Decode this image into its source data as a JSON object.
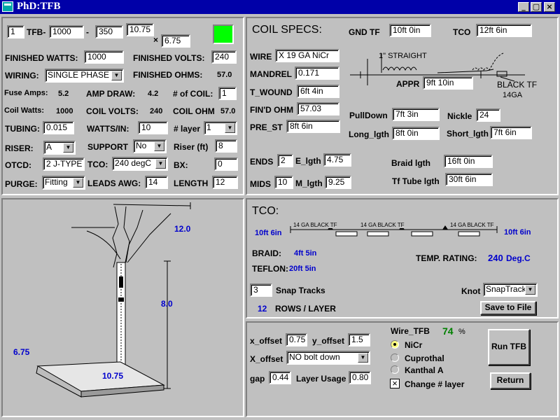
{
  "window": {
    "title": "PhD:TFB",
    "min_symbol": "_",
    "max_symbol": "▢",
    "close_symbol": "×",
    "icon": "app-icon"
  },
  "top": {
    "count": "1",
    "tfb_label": "TFB-",
    "tfb_a": "1000",
    "dash": "-",
    "tfb_b": "350",
    "dim_a": "10.75",
    "times": "×",
    "dim_b": "6.75",
    "status_color": "#00ff00"
  },
  "left": {
    "finished_watts_label": "FINISHED WATTS:",
    "finished_watts": "1000",
    "finished_volts_label": "FINISHED VOLTS:",
    "finished_volts": "240",
    "wiring_label": "WIRING:",
    "wiring": "SINGLE PHASE",
    "finished_ohms_label": "FINISHED OHMS:",
    "finished_ohms": "57.0",
    "fuse_amps_label": "Fuse Amps:",
    "fuse_amps": "5.2",
    "amp_draw_label": "AMP DRAW:",
    "amp_draw": "4.2",
    "num_coil_label": "# of COIL:",
    "num_coil": "1",
    "coil_watts_label": "Coil Watts:",
    "coil_watts": "1000",
    "coil_volts_label": "COIL VOLTS:",
    "coil_volts": "240",
    "coil_ohm_label": "COIL OHM",
    "coil_ohm": "57.0",
    "tubing_label": "TUBING:",
    "tubing": "0.015",
    "watts_in_label": "WATTS/IN:",
    "watts_in": "10",
    "layer_label": "# layer",
    "layer": "1",
    "riser_label": "RISER:",
    "riser": "A",
    "support_label": "SUPPORT",
    "support": "No",
    "riser_ft_label": "Riser (ft)",
    "riser_ft": "8",
    "otcd_label": "OTCD:",
    "otcd": "2 J-TYPE",
    "tco_label": "TCO:",
    "tco": "240 degC",
    "bx_label": "BX:",
    "bx": "0",
    "purge_label": "PURGE:",
    "purge": "Fitting",
    "leads_awg_label": "LEADS AWG:",
    "leads_awg": "14",
    "length_label": "LENGTH",
    "length": "12"
  },
  "coil": {
    "heading": "COIL SPECS:",
    "gnd_tf_label": "GND TF",
    "gnd_tf": "10ft 0in",
    "tco_label": "TCO",
    "tco": "12ft 6in",
    "wire_label": "WIRE",
    "wire": "X 19 GA NiCr",
    "mandrel_label": "MANDREL",
    "mandrel": "0.171",
    "t_wound_label": "T_WOUND",
    "t_wound": "6ft 4in",
    "find_ohm_label": "FIN'D OHM",
    "find_ohm": "57.03",
    "pre_st_label": "PRE_ST",
    "pre_st": "8ft 6in",
    "straight_label": "1\" STRAIGHT",
    "appr_label": "APPR",
    "appr": "9ft 10in",
    "black_tf_label": "BLACK TF",
    "black_tf_ga": "14GA",
    "pulldown_label": "PullDown",
    "pulldown": "7ft 3in",
    "nickle_label": "Nickle",
    "nickle": "24",
    "long_lgth_label": "Long_lgth",
    "long_lgth": "8ft 0in",
    "short_lgth_label": "Short_lgth",
    "short_lgth": "7ft 6in",
    "ends_label": "ENDS",
    "ends": "2",
    "e_lgth_label": "E_lgth",
    "e_lgth": "4.75",
    "braid_lgth_label": "Braid lgth",
    "braid_lgth": "16ft 0in",
    "mids_label": "MIDS",
    "mids": "10",
    "m_lgth_label": "M_lgth",
    "m_lgth": "9.25",
    "tf_tube_lgth_label": "Tf Tube lgth",
    "tf_tube_lgth": "30ft 6in"
  },
  "drawing": {
    "height_top": "12.0",
    "height_side": "8.0",
    "depth": "6.75",
    "width": "10.75"
  },
  "tco_panel": {
    "heading": "TCO:",
    "left_len": "10ft 6in",
    "right_len": "10ft 6in",
    "seg_label": "14 GA BLACK TF",
    "braid_label": "BRAID:",
    "braid": "4ft 5in",
    "teflon_label": "TEFLON:",
    "teflon": "20ft 5in",
    "temp_rating_label": "TEMP. RATING:",
    "temp_rating": "240",
    "temp_unit": "Deg.C",
    "snap_tracks": "3",
    "snap_tracks_label": "Snap Tracks",
    "knot_label": "Knot",
    "knot": "SnapTrack",
    "rows": "12",
    "rows_label": "ROWS / LAYER",
    "save_label": "Save to File"
  },
  "bottom": {
    "x_offset_label": "x_offset",
    "x_offset": "0.75",
    "y_offset_label": "y_offset",
    "y_offset": "1.5",
    "X_offset_label": "X_offset",
    "X_offset": "NO bolt down",
    "gap_label": "gap",
    "gap": "0.44",
    "layer_usage_label": "Layer Usage",
    "layer_usage": "0.80",
    "wire_tfb_label": "Wire_TFB",
    "percent": "74",
    "percent_sign": "%",
    "opt_nicr": "NiCr",
    "opt_cuprothal": "Cuprothal",
    "opt_kanthal": "Kanthal A",
    "change_layer_label": "Change # layer",
    "change_layer_mark": "×",
    "run_label": "Run TFB",
    "return_label": "Return"
  }
}
